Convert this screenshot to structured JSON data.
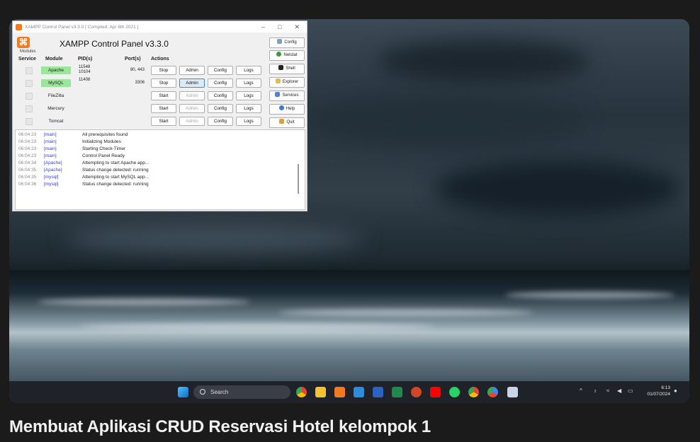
{
  "xampp": {
    "title_bar": "XAMPP Control Panel v3.3.0   [ Compiled: Apr 6th 2021 ]",
    "header_title": "XAMPP Control Panel v3.3.0",
    "modules_label": "Modules",
    "columns": {
      "service": "Service",
      "module": "Module",
      "pid": "PID(s)",
      "port": "Port(s)",
      "actions": "Actions"
    },
    "rows": [
      {
        "module": "Apache",
        "pid": "11548\n10104",
        "port": "80, 443",
        "start_stop": "Stop",
        "admin": "Admin",
        "config": "Config",
        "logs": "Logs",
        "running": true
      },
      {
        "module": "MySQL",
        "pid": "11408",
        "port": "3306",
        "start_stop": "Stop",
        "admin": "Admin",
        "config": "Config",
        "logs": "Logs",
        "running": true
      },
      {
        "module": "FileZilla",
        "pid": "",
        "port": "",
        "start_stop": "Start",
        "admin": "Admin",
        "config": "Config",
        "logs": "Logs",
        "running": false
      },
      {
        "module": "Mercury",
        "pid": "",
        "port": "",
        "start_stop": "Start",
        "admin": "Admin",
        "config": "Config",
        "logs": "Logs",
        "running": false
      },
      {
        "module": "Tomcat",
        "pid": "",
        "port": "",
        "start_stop": "Start",
        "admin": "Admin",
        "config": "Config",
        "logs": "Logs",
        "running": false
      }
    ],
    "side_buttons": [
      "Config",
      "Netstat",
      "Shell",
      "Explorer",
      "Services",
      "Help",
      "Quit"
    ],
    "log": [
      {
        "time": "06:04:23",
        "module": "[main]",
        "text": "All prerequisites found"
      },
      {
        "time": "06:04:23",
        "module": "[main]",
        "text": "Initializing Modules"
      },
      {
        "time": "06:04:23",
        "module": "[main]",
        "text": "Starting Check-Timer"
      },
      {
        "time": "06:04:23",
        "module": "[main]",
        "text": "Control Panel Ready"
      },
      {
        "time": "06:04:34",
        "module": "[Apache]",
        "text": "Attempting to start Apache app..."
      },
      {
        "time": "06:04:35",
        "module": "[Apache]",
        "text": "Status change detected: running"
      },
      {
        "time": "06:04:35",
        "module": "[mysql]",
        "text": "Attempting to start MySQL app..."
      },
      {
        "time": "06:04:36",
        "module": "[mysql]",
        "text": "Status change detected: running"
      }
    ]
  },
  "taskbar": {
    "search_placeholder": "Search",
    "time": "6:13",
    "date": "01/07/2024",
    "pinned_icons": [
      "windows-start-icon",
      "chrome-icon",
      "file-explorer-icon",
      "xampp-icon",
      "vscode-icon",
      "word-icon",
      "excel-icon",
      "powerpoint-icon",
      "youtube-icon",
      "whatsapp-icon",
      "chrome-profile-icon",
      "chrome-dev-icon",
      "capture-icon"
    ]
  },
  "video_title": "Membuat Aplikasi CRUD Reservasi Hotel kelompok 1"
}
